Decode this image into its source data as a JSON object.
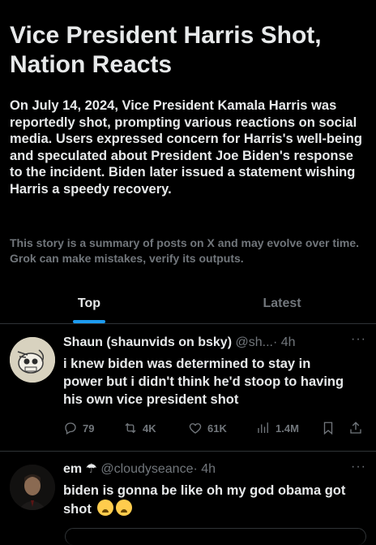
{
  "story": {
    "headline": "Vice President Harris Shot, Nation Reacts",
    "summary": "On July 14, 2024, Vice President Kamala Harris was reportedly shot, prompting various reactions on social media. Users expressed concern for Harris's well-being and speculated about President Joe Biden's response to the incident. Biden later issued a statement wishing Harris a speedy recovery.",
    "disclaimer": "This story is a summary of posts on X and may evolve over time. Grok can make mistakes, verify its outputs."
  },
  "tabs": [
    {
      "label": "Top",
      "active": true
    },
    {
      "label": "Latest",
      "active": false
    }
  ],
  "posts": [
    {
      "name": "Shaun (shaunvids on bsky)",
      "handle": "@sh...",
      "time": "· 4h",
      "more": "···",
      "text": "i knew biden was determined to stay in power but i didn't think he'd stoop to having his own vice president shot",
      "stats": {
        "replies": "79",
        "reposts": "4K",
        "likes": "61K",
        "views": "1.4M"
      }
    },
    {
      "name": "em",
      "name_icon": "umbrella-icon",
      "handle": "@cloudyseance",
      "time": "· 4h",
      "more": "···",
      "text": "biden is gonna be like oh my god obama got shot",
      "emojis": [
        "loudly-crying-face-icon",
        "loudly-crying-face-icon"
      ]
    }
  ],
  "colors": {
    "background": "#000000",
    "text": "#e7e9ea",
    "muted": "#71767b",
    "accent": "#1d9bf0",
    "divider": "#2f3336"
  }
}
